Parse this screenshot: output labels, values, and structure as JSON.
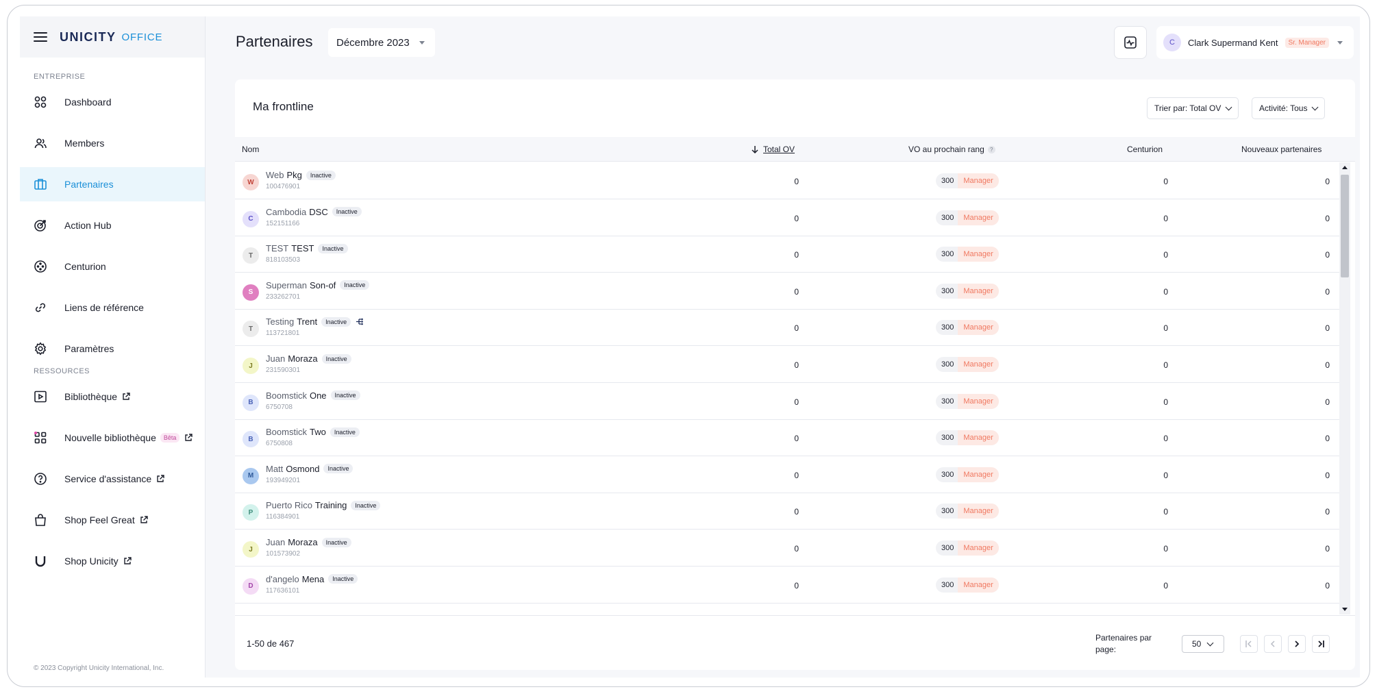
{
  "sidebar": {
    "logo": "UNICITY",
    "logo_sub": "OFFICE",
    "section_enterprise": "ENTREPRISE",
    "section_resources": "RESSOURCES",
    "items": [
      {
        "label": "Dashboard",
        "icon": "dashboard-icon"
      },
      {
        "label": "Members",
        "icon": "members-icon"
      },
      {
        "label": "Partenaires",
        "icon": "partners-icon"
      },
      {
        "label": "Action Hub",
        "icon": "target-icon"
      },
      {
        "label": "Centurion",
        "icon": "centurion-icon"
      },
      {
        "label": "Liens de référence",
        "icon": "link-icon"
      },
      {
        "label": "Paramètres",
        "icon": "gear-icon"
      }
    ],
    "resources": [
      {
        "label": "Bibliothèque",
        "icon": "play-icon"
      },
      {
        "label": "Nouvelle bibliothèque",
        "icon": "library-icon",
        "badge": "Bêta"
      },
      {
        "label": "Service d'assistance",
        "icon": "help-icon"
      },
      {
        "label": "Shop Feel Great",
        "icon": "bag-icon"
      },
      {
        "label": "Shop Unicity",
        "icon": "unicity-icon"
      }
    ],
    "copyright": "© 2023 Copyright Unicity International, Inc."
  },
  "header": {
    "title": "Partenaires",
    "month": "Décembre 2023",
    "user_initial": "C",
    "user_name": "Clark Supermand Kent",
    "user_rank": "Sr. Manager"
  },
  "card": {
    "title": "Ma frontline",
    "sort_label": "Trier par: Total OV",
    "activity_label": "Activité: Tous",
    "columns": {
      "name": "Nom",
      "total_ov": "Total OV",
      "vo_next": "VO au prochain rang",
      "centurion": "Centurion",
      "new_partners": "Nouveaux partenaires"
    },
    "rows": [
      {
        "initial": "W",
        "first": "Web",
        "last": "Pkg",
        "status": "Inactive",
        "id": "100476901",
        "total_ov": "0",
        "vo": "300",
        "rank": "Manager",
        "centurion": "0",
        "new": "0"
      },
      {
        "initial": "C",
        "first": "Cambodia",
        "last": "DSC",
        "status": "Inactive",
        "id": "152151166",
        "total_ov": "0",
        "vo": "300",
        "rank": "Manager",
        "centurion": "0",
        "new": "0"
      },
      {
        "initial": "T",
        "first": "TEST",
        "last": "TEST",
        "status": "Inactive",
        "id": "818103503",
        "total_ov": "0",
        "vo": "300",
        "rank": "Manager",
        "centurion": "0",
        "new": "0"
      },
      {
        "initial": "S",
        "first": "Superman",
        "last": "Son-of",
        "status": "Inactive",
        "id": "233262701",
        "total_ov": "0",
        "vo": "300",
        "rank": "Manager",
        "centurion": "0",
        "new": "0"
      },
      {
        "initial": "T",
        "first": "Testing",
        "last": "Trent",
        "status": "Inactive",
        "id": "113721801",
        "total_ov": "0",
        "vo": "300",
        "rank": "Manager",
        "centurion": "0",
        "new": "0"
      },
      {
        "initial": "J",
        "first": "Juan",
        "last": "Moraza",
        "status": "Inactive",
        "id": "231590301",
        "total_ov": "0",
        "vo": "300",
        "rank": "Manager",
        "centurion": "0",
        "new": "0"
      },
      {
        "initial": "B",
        "first": "Boomstick",
        "last": "One",
        "status": "Inactive",
        "id": "6750708",
        "total_ov": "0",
        "vo": "300",
        "rank": "Manager",
        "centurion": "0",
        "new": "0"
      },
      {
        "initial": "B",
        "first": "Boomstick",
        "last": "Two",
        "status": "Inactive",
        "id": "6750808",
        "total_ov": "0",
        "vo": "300",
        "rank": "Manager",
        "centurion": "0",
        "new": "0"
      },
      {
        "initial": "M",
        "first": "Matt",
        "last": "Osmond",
        "status": "Inactive",
        "id": "193949201",
        "total_ov": "0",
        "vo": "300",
        "rank": "Manager",
        "centurion": "0",
        "new": "0"
      },
      {
        "initial": "P",
        "first": "Puerto Rico",
        "last": "Training",
        "status": "Inactive",
        "id": "116384901",
        "total_ov": "0",
        "vo": "300",
        "rank": "Manager",
        "centurion": "0",
        "new": "0"
      },
      {
        "initial": "J",
        "first": "Juan",
        "last": "Moraza",
        "status": "Inactive",
        "id": "101573902",
        "total_ov": "0",
        "vo": "300",
        "rank": "Manager",
        "centurion": "0",
        "new": "0"
      },
      {
        "initial": "D",
        "first": "d'angelo",
        "last": "Mena",
        "status": "Inactive",
        "id": "117636101",
        "total_ov": "0",
        "vo": "300",
        "rank": "Manager",
        "centurion": "0",
        "new": "0"
      }
    ],
    "avatar_colors": [
      {
        "bg": "#f7d6d2",
        "fg": "#c2453a"
      },
      {
        "bg": "#e4e0fb",
        "fg": "#5a4fc7"
      },
      {
        "bg": "#ececec",
        "fg": "#6a6a6a"
      },
      {
        "bg": "#e07fc0",
        "fg": "#ffffff"
      },
      {
        "bg": "#ececec",
        "fg": "#6a6a6a"
      },
      {
        "bg": "#f3f6c8",
        "fg": "#7a7a20"
      },
      {
        "bg": "#dfe6fb",
        "fg": "#4a63b7"
      },
      {
        "bg": "#dfe6fb",
        "fg": "#4a63b7"
      },
      {
        "bg": "#a9c8ef",
        "fg": "#2f5a9a"
      },
      {
        "bg": "#d3f2ec",
        "fg": "#3f8f7c"
      },
      {
        "bg": "#f3f6c8",
        "fg": "#7a7a20"
      },
      {
        "bg": "#f4dbf5",
        "fg": "#a245a8"
      }
    ]
  },
  "pagination": {
    "range": "1-50 de 467",
    "per_page_label": "Partenaires par page:",
    "per_page_value": "50"
  }
}
